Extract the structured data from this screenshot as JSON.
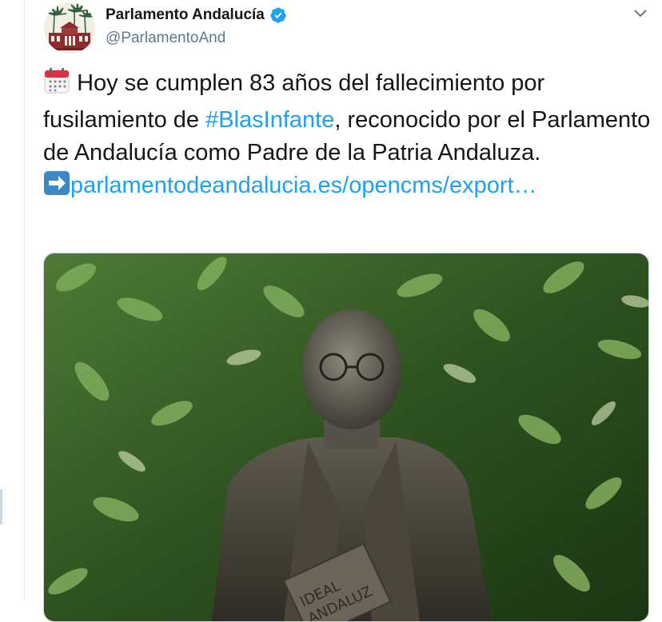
{
  "tweet": {
    "author": {
      "display_name": "Parlamento Andalucía",
      "handle": "@ParlamentoAnd",
      "verified": true,
      "avatar_icon": "parliament-building-icon"
    },
    "text": {
      "emoji_calendar": "calendar-icon",
      "part1": "Hoy se cumplen 83 años del fallecimiento por fusilamiento de ",
      "hashtag": "#BlasInfante",
      "part2": ", reconocido por el Parlamento de Andalucía como Padre de la Patria Andaluza.",
      "emoji_arrow": "right-arrow-icon",
      "link": "parlamentodeandalucia.es/opencms/export…"
    },
    "media": {
      "type": "photo",
      "subject_icon": "bronze-statue-bust-photo",
      "book_inscription": "IDEAL ANDALUZ"
    },
    "menu_icon": "chevron-down-icon"
  },
  "colors": {
    "link": "#1da1f2",
    "verified": "#1da1f2",
    "text": "#14171a",
    "secondary": "#657786"
  }
}
